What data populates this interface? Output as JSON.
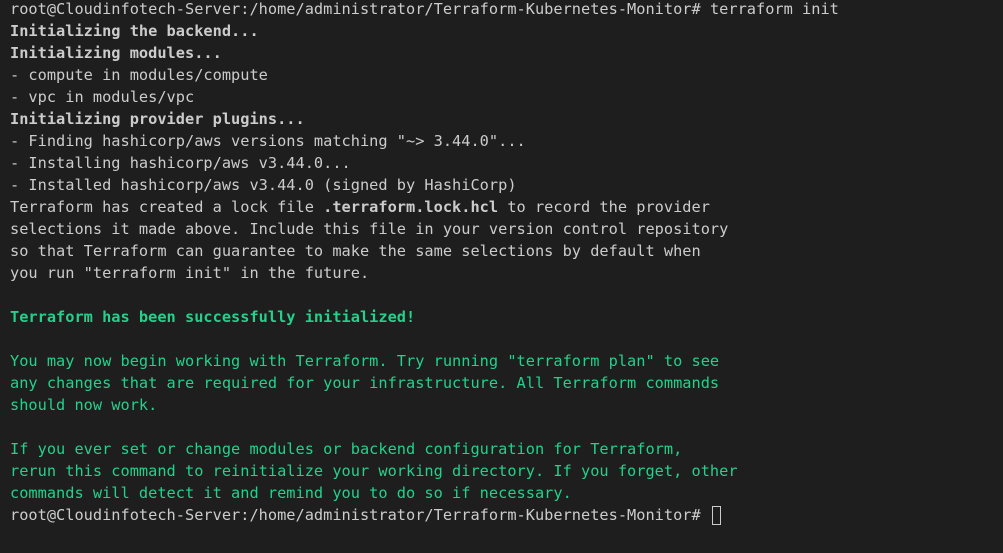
{
  "terminal": {
    "prompt": "root@Cloudinfotech-Server:/home/administrator/Terraform-Kubernetes-Monitor#",
    "command": "terraform init",
    "init_backend": "Initializing the backend...",
    "init_modules": "Initializing modules...",
    "module_compute": "- compute in modules/compute",
    "module_vpc": "- vpc in modules/vpc",
    "init_plugins": "Initializing provider plugins...",
    "finding": "- Finding hashicorp/aws versions matching \"~> 3.44.0\"...",
    "installing": "- Installing hashicorp/aws v3.44.0...",
    "installed": "- Installed hashicorp/aws v3.44.0 (signed by HashiCorp)",
    "lock_pre": "Terraform has created a lock file ",
    "lock_file": ".terraform.lock.hcl",
    "lock_post": " to record the provider",
    "lock_line2": "selections it made above. Include this file in your version control repository",
    "lock_line3": "so that Terraform can guarantee to make the same selections by default when",
    "lock_line4": "you run \"terraform init\" in the future.",
    "success": "Terraform has been successfully initialized!",
    "begin_line1": "You may now begin working with Terraform. Try running \"terraform plan\" to see",
    "begin_line2": "any changes that are required for your infrastructure. All Terraform commands",
    "begin_line3": "should now work.",
    "rerun_line1": "If you ever set or change modules or backend configuration for Terraform,",
    "rerun_line2": "rerun this command to reinitialize your working directory. If you forget, other",
    "rerun_line3": "commands will detect it and remind you to do so if necessary.",
    "final_prompt": "root@Cloudinfotech-Server:/home/administrator/Terraform-Kubernetes-Monitor#"
  },
  "colors": {
    "background": "#1e1e1e",
    "text": "#cccccc",
    "success": "#23d18b"
  }
}
